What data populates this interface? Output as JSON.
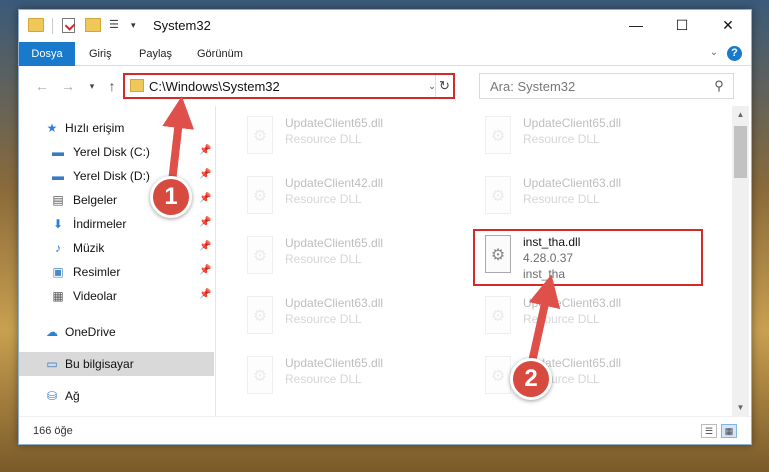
{
  "window": {
    "title": "System32",
    "minimize_glyph": "—",
    "maximize_glyph": "☐",
    "close_glyph": "✕"
  },
  "quick_access_toolbar": {
    "view_glyph": "☰",
    "dropdown_glyph": "▾"
  },
  "ribbon": {
    "tabs": [
      {
        "label": "Dosya",
        "active": true
      },
      {
        "label": "Giriş"
      },
      {
        "label": "Paylaş"
      },
      {
        "label": "Görünüm"
      }
    ],
    "expand_glyph": "⌄",
    "help_label": "?"
  },
  "navigation": {
    "back_glyph": "←",
    "forward_glyph": "→",
    "recent_glyph": "▾",
    "up_glyph": "↑",
    "address_path": "C:\\Windows\\System32",
    "address_dropdown_glyph": "⌄",
    "refresh_glyph": "↻",
    "search_placeholder": "Ara: System32",
    "search_glyph": "⚲"
  },
  "sidebar": {
    "pin_glyph": "📌",
    "items": [
      {
        "label": "Hızlı erişim",
        "icon": "star-icon",
        "glyph": "★",
        "color": "#2b7fd4",
        "pinned": false
      },
      {
        "label": "Yerel Disk (C:)",
        "icon": "drive-icon",
        "glyph": "▬",
        "color": "#3a7bbf",
        "pinned": true
      },
      {
        "label": "Yerel Disk (D:)",
        "icon": "drive-icon",
        "glyph": "▬",
        "color": "#3a7bbf",
        "pinned": true
      },
      {
        "label": "Belgeler",
        "icon": "documents-icon",
        "glyph": "▤",
        "color": "#555",
        "pinned": true
      },
      {
        "label": "İndirmeler",
        "icon": "download-icon",
        "glyph": "⬇",
        "color": "#2b7fd4",
        "pinned": true
      },
      {
        "label": "Müzik",
        "icon": "music-icon",
        "glyph": "♪",
        "color": "#2b7fd4",
        "pinned": true
      },
      {
        "label": "Resimler",
        "icon": "pictures-icon",
        "glyph": "▣",
        "color": "#4a8ac4",
        "pinned": true
      },
      {
        "label": "Videolar",
        "icon": "video-icon",
        "glyph": "▦",
        "color": "#555",
        "pinned": true
      },
      {
        "label": "OneDrive",
        "icon": "cloud-icon",
        "glyph": "☁",
        "color": "#2b7fd4",
        "pinned": false
      },
      {
        "label": "Bu bilgisayar",
        "icon": "computer-icon",
        "glyph": "▭",
        "color": "#3a7bbf",
        "pinned": false,
        "selected": true
      },
      {
        "label": "Ağ",
        "icon": "network-icon",
        "glyph": "⛁",
        "color": "#3a7bbf",
        "pinned": false
      }
    ]
  },
  "files": [
    {
      "name": "UpdateClient65.dll",
      "description": "Resource DLL",
      "faded": true
    },
    {
      "name": "UpdateClient65.dll",
      "description": "Resource DLL",
      "faded": true
    },
    {
      "name": "UpdateClient42.dll",
      "description": "Resource DLL",
      "faded": true
    },
    {
      "name": "UpdateClient63.dll",
      "description": "Resource DLL",
      "faded": true
    },
    {
      "name": "UpdateClient65.dll",
      "description": "Resource DLL",
      "faded": true
    },
    {
      "name": "inst_tha.dll",
      "version": "4.28.0.37",
      "description": "inst_tha",
      "faded": false,
      "highlighted": true
    },
    {
      "name": "UpdateClient63.dll",
      "description": "Resource DLL",
      "faded": true
    },
    {
      "name": "UpdateClient63.dll",
      "description": "Resource DLL",
      "faded": true
    },
    {
      "name": "UpdateClient65.dll",
      "description": "Resource DLL",
      "faded": true
    },
    {
      "name": "UpdateClient65.dll",
      "description": "Resource DLL",
      "faded": true
    }
  ],
  "file_icon_glyph": "⚙",
  "scrollbar": {
    "up_glyph": "▲",
    "down_glyph": "▼"
  },
  "status": {
    "item_count": "166 öğe",
    "details_glyph": "☰",
    "tiles_glyph": "▦"
  },
  "annotations": {
    "step1": "1",
    "step2": "2",
    "highlight_color": "#d42a2a",
    "arrow_color": "#e0504a"
  }
}
